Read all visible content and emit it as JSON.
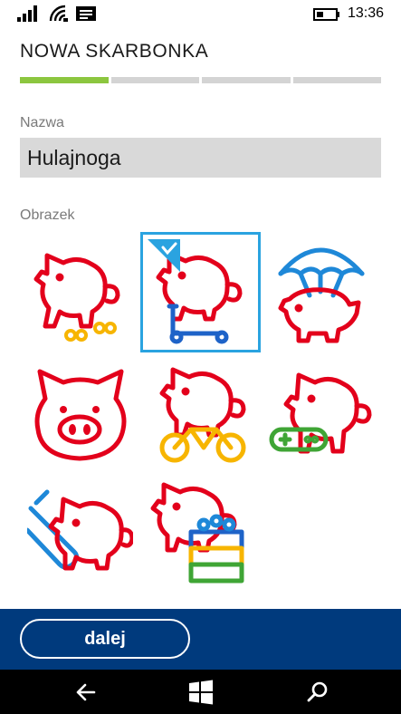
{
  "status_bar": {
    "time": "13:36",
    "icons": [
      "signal-icon",
      "wifi-icon",
      "message-icon",
      "battery-icon"
    ]
  },
  "header": {
    "title": "NOWA SKARBONKA",
    "progress": {
      "steps_total": 4,
      "steps_done": 1
    }
  },
  "form": {
    "name_label": "Nazwa",
    "name_value": "Hulajnoga",
    "image_label": "Obrazek",
    "images": [
      {
        "name": "pig-with-wheels-image",
        "selected": false
      },
      {
        "name": "pig-on-scooter-image",
        "selected": true
      },
      {
        "name": "pig-with-parachute-image",
        "selected": false
      },
      {
        "name": "pig-face-image",
        "selected": false
      },
      {
        "name": "pig-on-bicycle-image",
        "selected": false
      },
      {
        "name": "pig-with-gamepad-image",
        "selected": false
      },
      {
        "name": "pig-with-surfboard-image",
        "selected": false
      },
      {
        "name": "pig-with-toy-blocks-image",
        "selected": false
      }
    ]
  },
  "actions": {
    "next_label": "dalej"
  },
  "colors": {
    "accent_green": "#8cc63f",
    "selection_blue": "#2aa3e0",
    "action_bar": "#003a7d",
    "pig_red": "#e3001b",
    "pig_pink": "#e5007e"
  }
}
